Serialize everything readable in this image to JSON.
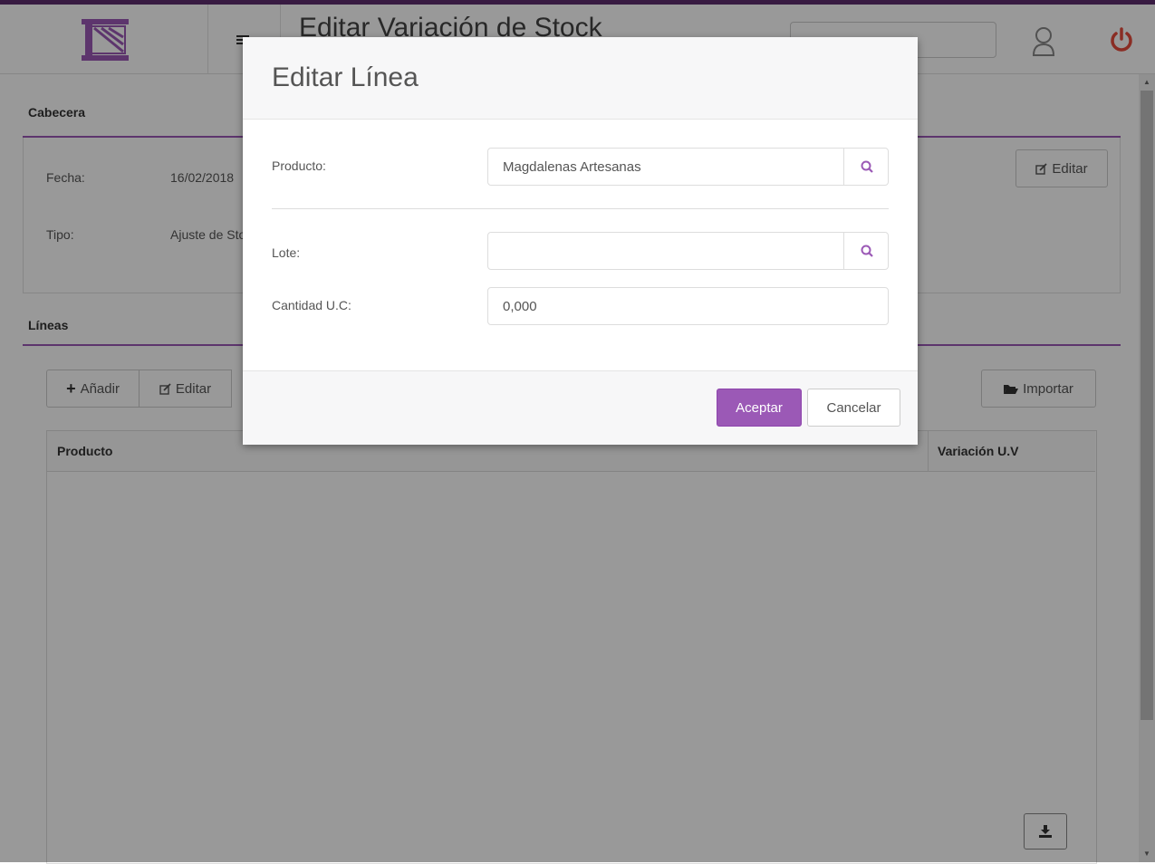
{
  "colors": {
    "accent": "#9b59b6",
    "brand_dark": "#5e2d6e",
    "power": "#e74c3c"
  },
  "header": {
    "title": "Editar Variación de Stock",
    "menu_icon": "hamburger-icon",
    "user_icon": "user-icon",
    "power_icon": "power-icon"
  },
  "cabecera": {
    "title": "Cabecera",
    "edit_label": "Editar",
    "fecha_label": "Fecha:",
    "fecha_value": "16/02/2018",
    "tipo_label": "Tipo:",
    "tipo_value": "Ajuste de Stock"
  },
  "lineas": {
    "title": "Líneas",
    "add_label": "Añadir",
    "edit_label": "Editar",
    "import_label": "Importar",
    "columns": [
      "Producto",
      "Variación U.V"
    ]
  },
  "modal": {
    "title": "Editar Línea",
    "producto_label": "Producto:",
    "producto_value": "Magdalenas Artesanas",
    "lote_label": "Lote:",
    "lote_value": "",
    "cantidad_label": "Cantidad U.C:",
    "cantidad_value": "0,000",
    "accept_label": "Aceptar",
    "cancel_label": "Cancelar"
  }
}
